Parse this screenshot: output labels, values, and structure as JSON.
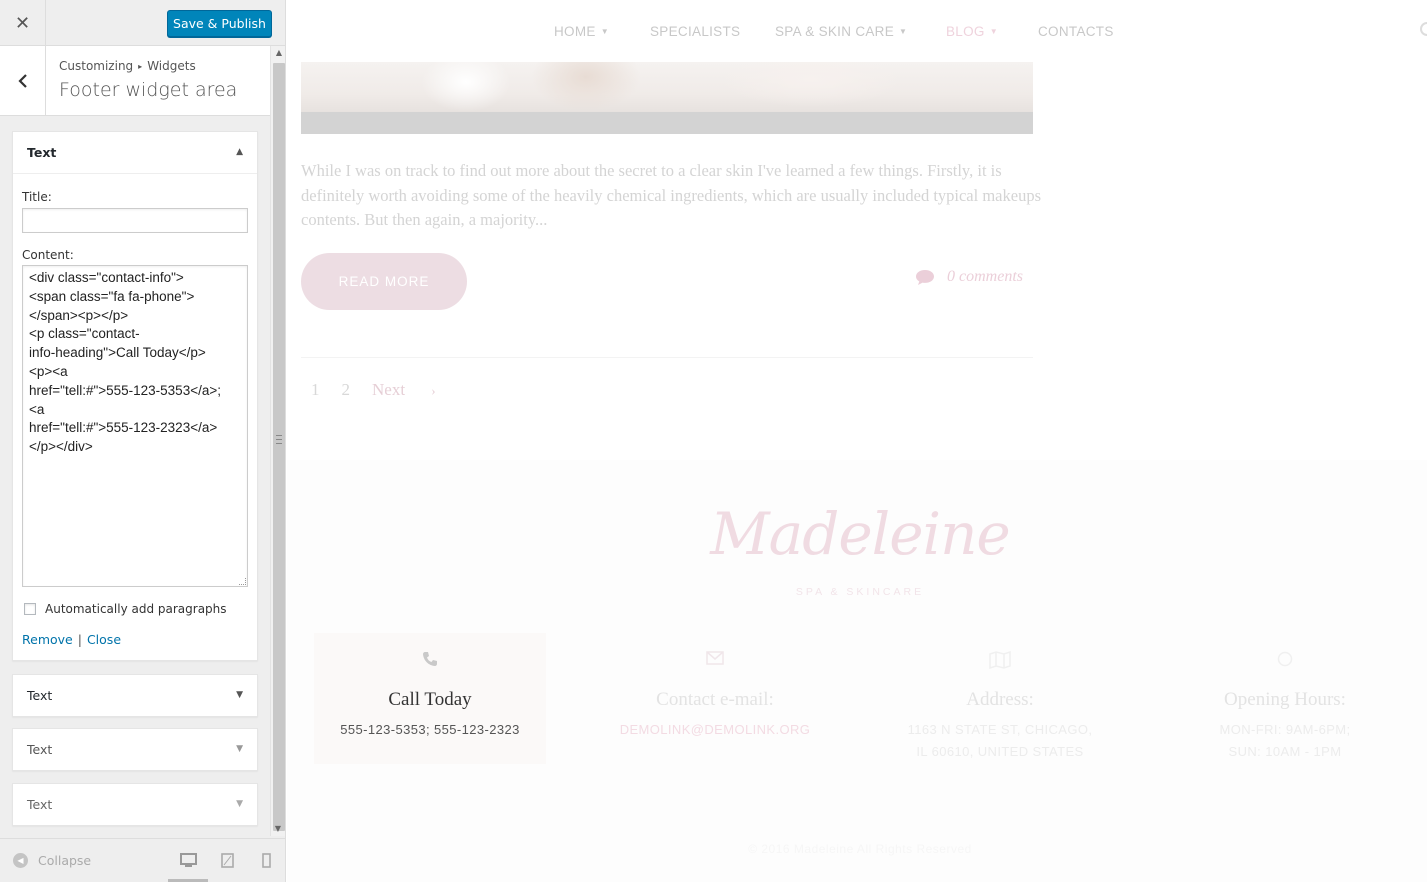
{
  "customizer": {
    "close_icon": "close-icon",
    "publish_label": "Save & Publish",
    "breadcrumb": [
      "Customizing",
      "Widgets"
    ],
    "section_title": "Footer widget area",
    "widgets": [
      {
        "title": "Text",
        "expanded": true,
        "title_label": "Title:",
        "title_value": "",
        "content_label": "Content:",
        "content_value": "<div class=\"contact-info\">\n<span class=\"fa fa-phone\">\n</span><p></p>\n<p class=\"contact-\ninfo-heading\">Call Today</p>\n<p><a\nhref=\"tell:#\">555-123-5353</a>;\n<a\nhref=\"tell:#\">555-123-2323</a>\n</p></div>",
        "autop_label": "Automatically add paragraphs",
        "autop_checked": false,
        "remove_label": "Remove",
        "separator": "|",
        "close_label": "Close"
      },
      {
        "title": "Text",
        "expanded": false
      },
      {
        "title": "Text",
        "expanded": false
      },
      {
        "title": "Text",
        "expanded": false
      }
    ],
    "collapse_label": "Collapse",
    "devices": [
      "desktop-icon",
      "tablet-icon",
      "mobile-icon"
    ],
    "accent_color": "#0085ba"
  },
  "preview": {
    "nav": [
      "HOME",
      "SPECIALISTS",
      "SPA & SKIN CARE",
      "BLOG",
      "CONTACTS"
    ],
    "excerpt": "While I was on track to find out more about the secret to a clear skin I've learned a few things. Firstly, it is definitely worth avoiding some of the heavily chemical ingredients, which are usually included typical makeups contents. But then again, a majority...",
    "read_more": "READ MORE",
    "comments": "0 comments",
    "pagination": [
      "1",
      "2",
      "Next"
    ],
    "logo": "Madeleine",
    "logo_sub": "SPA & SKINCARE",
    "contact": [
      {
        "icon": "phone-icon",
        "heading": "Call Today",
        "body": "555-123-5353; 555-123-2323"
      },
      {
        "icon": "envelope-icon",
        "heading": "Contact e-mail:",
        "body": "DEMOLINK@DEMOLINK.ORG"
      },
      {
        "icon": "map-icon",
        "heading": "Address:",
        "body": "1163 N STATE ST, CHICAGO, IL 60610, UNITED STATES"
      },
      {
        "icon": "clock-icon",
        "heading": "Opening Hours:",
        "body": "MON-FRI: 9AM-6PM; SUN: 10AM - 1PM"
      }
    ],
    "copyright": "© 2016 Madeleine All Rights Reserved",
    "brand_pink": "#ebcfd9"
  }
}
